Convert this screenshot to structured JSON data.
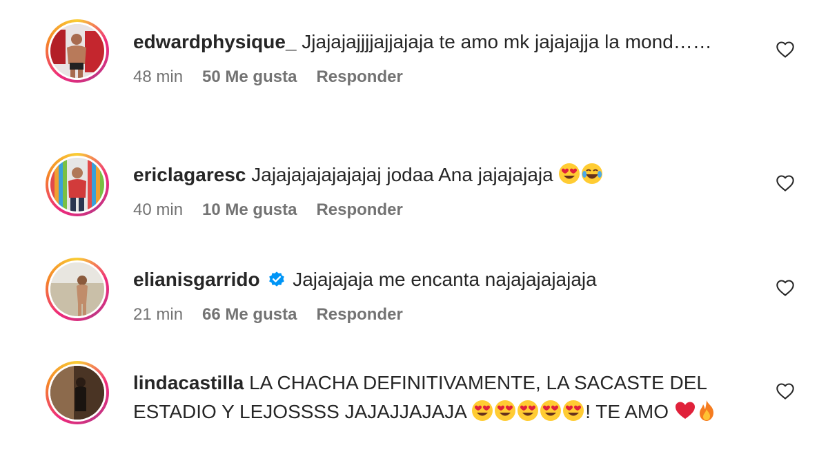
{
  "comments": [
    {
      "username": "edwardphysique_",
      "verified": false,
      "text": "Jjajajajjjjajjajaja te amo mk jajajajja la mond……",
      "emojis": [],
      "text_after": "",
      "emojis_after": [],
      "time": "48 min",
      "likes": "50 Me gusta",
      "reply_label": "Responder"
    },
    {
      "username": "ericlagaresc",
      "verified": false,
      "text": "Jajajajajajajajaj jodaa Ana jajajajaja",
      "emojis": [
        "heart-eyes",
        "tears-of-joy"
      ],
      "text_after": "",
      "emojis_after": [],
      "time": "40 min",
      "likes": "10 Me gusta",
      "reply_label": "Responder"
    },
    {
      "username": "elianisgarrido",
      "verified": true,
      "text": "Jajajajaja me encanta najajajajajaja",
      "emojis": [],
      "text_after": "",
      "emojis_after": [],
      "time": "21 min",
      "likes": "66 Me gusta",
      "reply_label": "Responder"
    },
    {
      "username": "lindacastilla",
      "verified": false,
      "text": "LA CHACHA DEFINITIVAMENTE, LA SACASTE DEL ESTADIO Y LEJOSSSS JAJAJJAJAJA",
      "emojis": [
        "heart-eyes",
        "heart-eyes",
        "heart-eyes",
        "heart-eyes",
        "heart-eyes"
      ],
      "text_after": "! TE AMO",
      "emojis_after": [
        "red-heart",
        "fire"
      ]
    }
  ],
  "colors": {
    "text": "#262626",
    "meta": "#737373",
    "verified": "#0095f6"
  }
}
